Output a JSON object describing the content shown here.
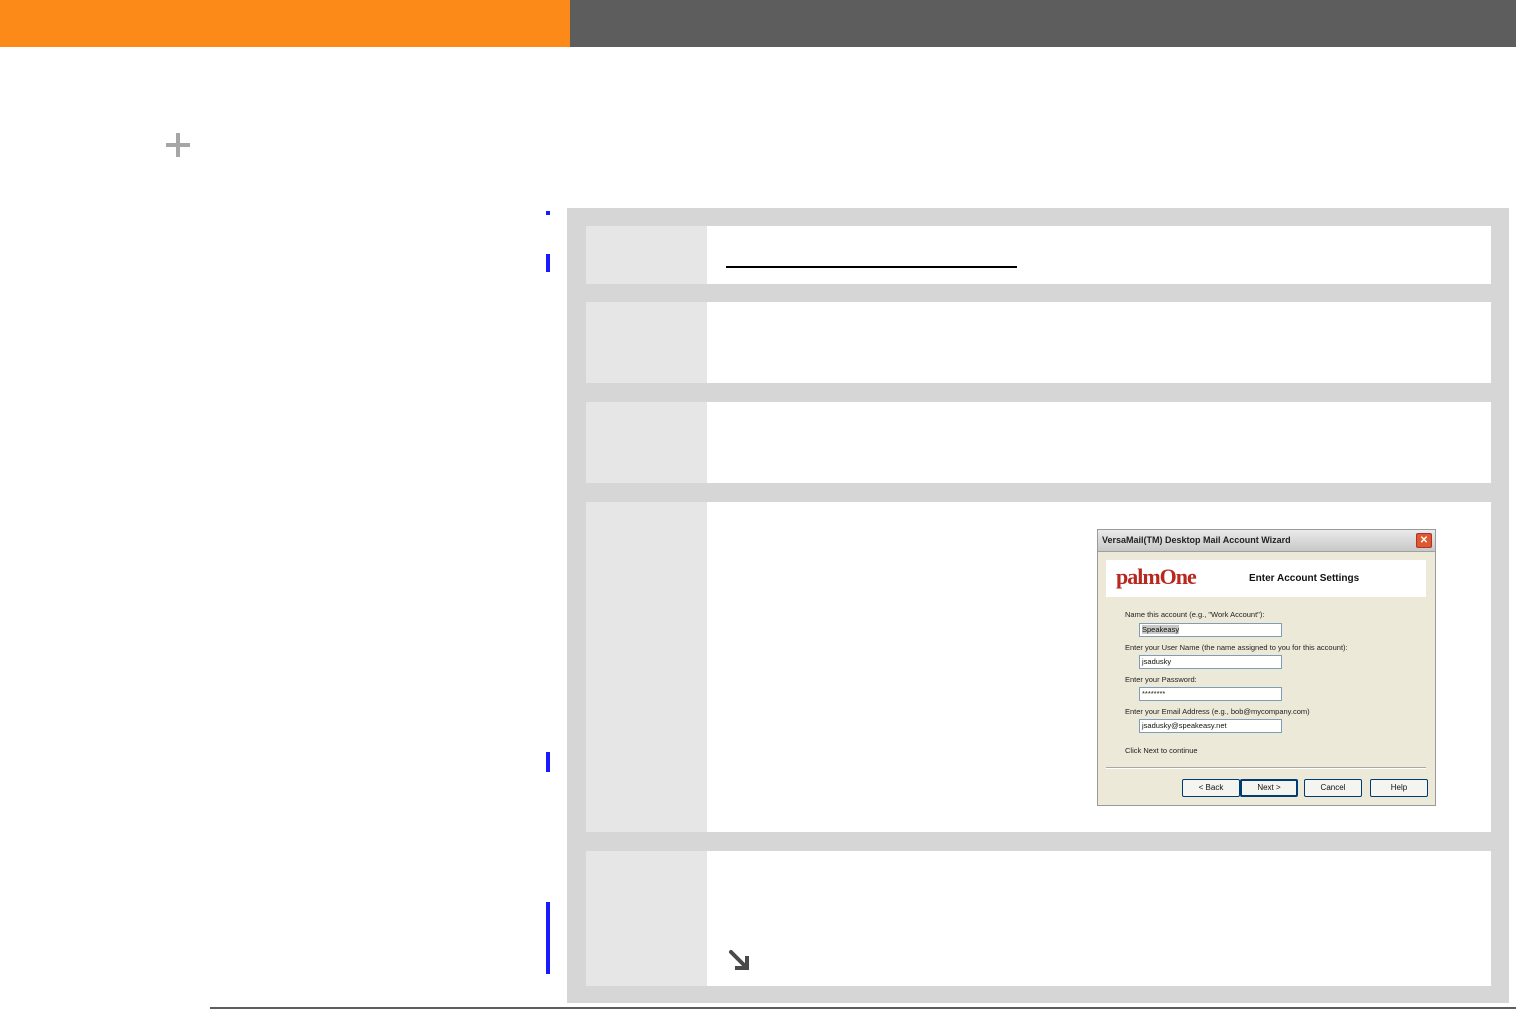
{
  "icons": {
    "expand": "plus-icon",
    "continue": "arrow-down-right-icon",
    "close": "close-icon"
  },
  "colors": {
    "header_accent": "#fb8a18",
    "header_bar": "#5d5d5d",
    "change_bar": "#1a1aff",
    "panel": "#d6d6d6",
    "step_number_cell": "#e6e6e6"
  },
  "wizard": {
    "title": "VersaMail(TM) Desktop Mail Account Wizard",
    "logo": "palmOne",
    "heading": "Enter Account Settings",
    "fields": [
      {
        "label": "Name this account (e.g., \"Work Account\"):",
        "value": "Speakeasy"
      },
      {
        "label": "Enter your User Name (the name assigned to you for this account):",
        "value": "jsadusky"
      },
      {
        "label": "Enter your Password:",
        "value": "********"
      },
      {
        "label": "Enter your Email Address (e.g., bob@mycompany.com)",
        "value": "jsadusky@speakeasy.net"
      }
    ],
    "hint": "Click Next to continue",
    "buttons": {
      "back": "< Back",
      "next": "Next >",
      "cancel": "Cancel",
      "help": "Help"
    }
  }
}
